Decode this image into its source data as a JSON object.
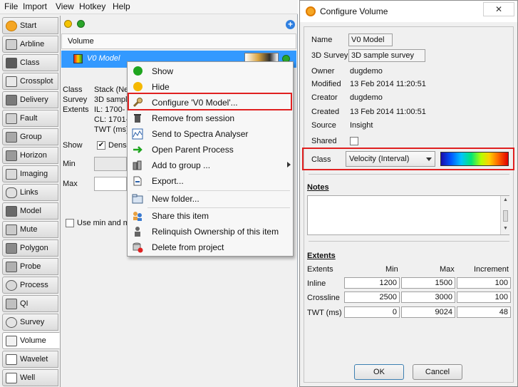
{
  "menubar": {
    "items": [
      "File",
      "Import",
      "View",
      "Hotkey",
      "Help"
    ]
  },
  "sidebar": {
    "active": "Volume",
    "items": [
      {
        "label": "Start",
        "icon": "start-icon"
      },
      {
        "label": "Arbline",
        "icon": "arbline-icon"
      },
      {
        "label": "Class",
        "icon": "class-icon"
      },
      {
        "label": "Crossplot",
        "icon": "crossplot-icon"
      },
      {
        "label": "Delivery",
        "icon": "delivery-icon"
      },
      {
        "label": "Fault",
        "icon": "fault-icon"
      },
      {
        "label": "Group",
        "icon": "group-icon"
      },
      {
        "label": "Horizon",
        "icon": "horizon-icon"
      },
      {
        "label": "Imaging",
        "icon": "imaging-icon"
      },
      {
        "label": "Links",
        "icon": "links-icon"
      },
      {
        "label": "Model",
        "icon": "model-icon"
      },
      {
        "label": "Mute",
        "icon": "mute-icon"
      },
      {
        "label": "Polygon",
        "icon": "polygon-icon"
      },
      {
        "label": "Probe",
        "icon": "probe-icon"
      },
      {
        "label": "Process",
        "icon": "process-icon"
      },
      {
        "label": "QI",
        "icon": "qi-icon"
      },
      {
        "label": "Survey",
        "icon": "survey-icon"
      },
      {
        "label": "Volume",
        "icon": "volume-icon"
      },
      {
        "label": "Wavelet",
        "icon": "wavelet-icon"
      },
      {
        "label": "Well",
        "icon": "well-icon"
      }
    ]
  },
  "content": {
    "plus": "+",
    "column_header": "Volume",
    "selected_row": {
      "name": "V0 Model"
    },
    "details": {
      "class_label": "Class",
      "class_value": "Stack (Ne",
      "survey_label": "Survey",
      "survey_value": "3D sample",
      "extents_label": "Extents",
      "il_value": "IL: 1700-",
      "cl_value": "CL: 1701-",
      "twt_value": "TWT (ms)",
      "show_label": "Show",
      "show_check_label": "Densi",
      "min_label": "Min",
      "max_label": "Max",
      "minmax_label": "Use min and m"
    }
  },
  "context_menu": {
    "items": [
      {
        "label": "Show",
        "icon": "green-dot-icon"
      },
      {
        "label": "Hide",
        "icon": "yellow-dot-icon"
      },
      {
        "label": "Configure  'V0 Model'...",
        "icon": "wrench-icon"
      },
      {
        "label": "Remove from session",
        "icon": "trash-icon"
      },
      {
        "label": "Send to Spectra Analyser",
        "icon": "spectrum-icon"
      },
      {
        "label": "Open Parent Process",
        "icon": "green-arrow-icon"
      },
      {
        "label": "Add to group ...",
        "icon": "group-icon"
      },
      {
        "label": "Export...",
        "icon": "export-icon"
      },
      {
        "label": "New folder...",
        "icon": "folder-icon"
      },
      {
        "label": "Share this item",
        "icon": "share-icon"
      },
      {
        "label": "Relinquish Ownership of this item",
        "icon": "relinquish-icon"
      },
      {
        "label": "Delete from project",
        "icon": "delete-db-icon"
      }
    ]
  },
  "dialog": {
    "title": "Configure Volume",
    "close": "✕",
    "fields": {
      "name_label": "Name",
      "name_value": "V0 Model",
      "survey_label": "3D Survey",
      "survey_value": "3D sample survey",
      "owner_label": "Owner",
      "owner_value": "dugdemo",
      "modified_label": "Modified",
      "modified_value": "13 Feb 2014 11:20:51",
      "creator_label": "Creator",
      "creator_value": "dugdemo",
      "created_label": "Created",
      "created_value": "13 Feb 2014 11:00:51",
      "source_label": "Source",
      "source_value": "Insight",
      "shared_label": "Shared",
      "class_label": "Class",
      "class_value": "Velocity (Interval)"
    },
    "notes_title": "Notes",
    "extents": {
      "title": "Extents",
      "headers": [
        "Extents",
        "Min",
        "Max",
        "Increment"
      ],
      "rows": [
        {
          "label": "Inline",
          "min": "1200",
          "max": "1500",
          "inc": "100"
        },
        {
          "label": "Crossline",
          "min": "2500",
          "max": "3000",
          "inc": "100"
        },
        {
          "label": "TWT (ms)",
          "min": "0",
          "max": "9024",
          "inc": "48"
        }
      ]
    },
    "ok": "OK",
    "cancel": "Cancel"
  },
  "colors": {
    "highlight_border": "#e02020",
    "selection_blue": "#3399ff"
  }
}
